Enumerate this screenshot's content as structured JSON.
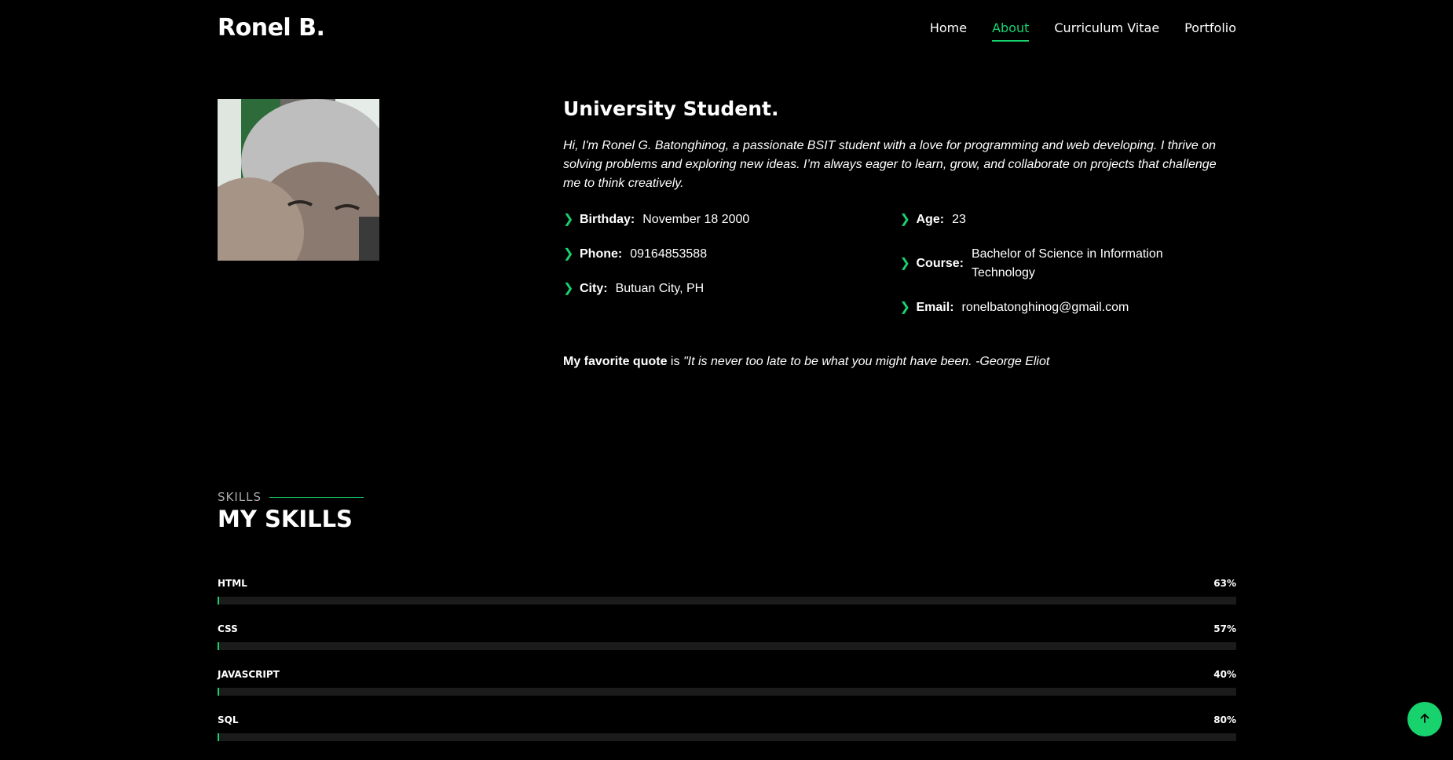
{
  "brand": "Ronel B.",
  "nav": [
    {
      "label": "Home",
      "active": false
    },
    {
      "label": "About",
      "active": true
    },
    {
      "label": "Curriculum Vitae",
      "active": false
    },
    {
      "label": "Portfolio",
      "active": false
    }
  ],
  "about": {
    "heading": "University Student.",
    "intro": "Hi, I'm Ronel G. Batonghinog, a passionate BSIT student with a love for programming and web developing. I thrive on solving problems and exploring new ideas. I’m always eager to learn, grow, and collaborate on projects that challenge me to think creatively.",
    "left": [
      {
        "label": "Birthday:",
        "value": "November 18 2000"
      },
      {
        "label": "Phone:",
        "value": "09164853588"
      },
      {
        "label": "City:",
        "value": "Butuan City, PH"
      }
    ],
    "right": [
      {
        "label": "Age:",
        "value": "23"
      },
      {
        "label": "Course:",
        "value": "Bachelor of Science in Information Technology"
      },
      {
        "label": "Email:",
        "value": "ronelbatonghinog@gmail.com"
      }
    ],
    "quote_label": "My favorite quote",
    "quote_is": "is",
    "quote_text": "\"It is never too late to be what you might have been. -George Eliot"
  },
  "skills": {
    "tag": "SKILLS",
    "title": "MY SKILLS",
    "items": [
      {
        "name": "HTML",
        "percent": "63%"
      },
      {
        "name": "CSS",
        "percent": "57%"
      },
      {
        "name": "JAVASCRIPT",
        "percent": "40%"
      },
      {
        "name": "SQL",
        "percent": "80%"
      }
    ]
  },
  "icons": {
    "chevron": "chevron-right-icon",
    "back_to_top": "arrow-up-icon"
  },
  "colors": {
    "accent": "#18d26e",
    "background": "#000000"
  }
}
